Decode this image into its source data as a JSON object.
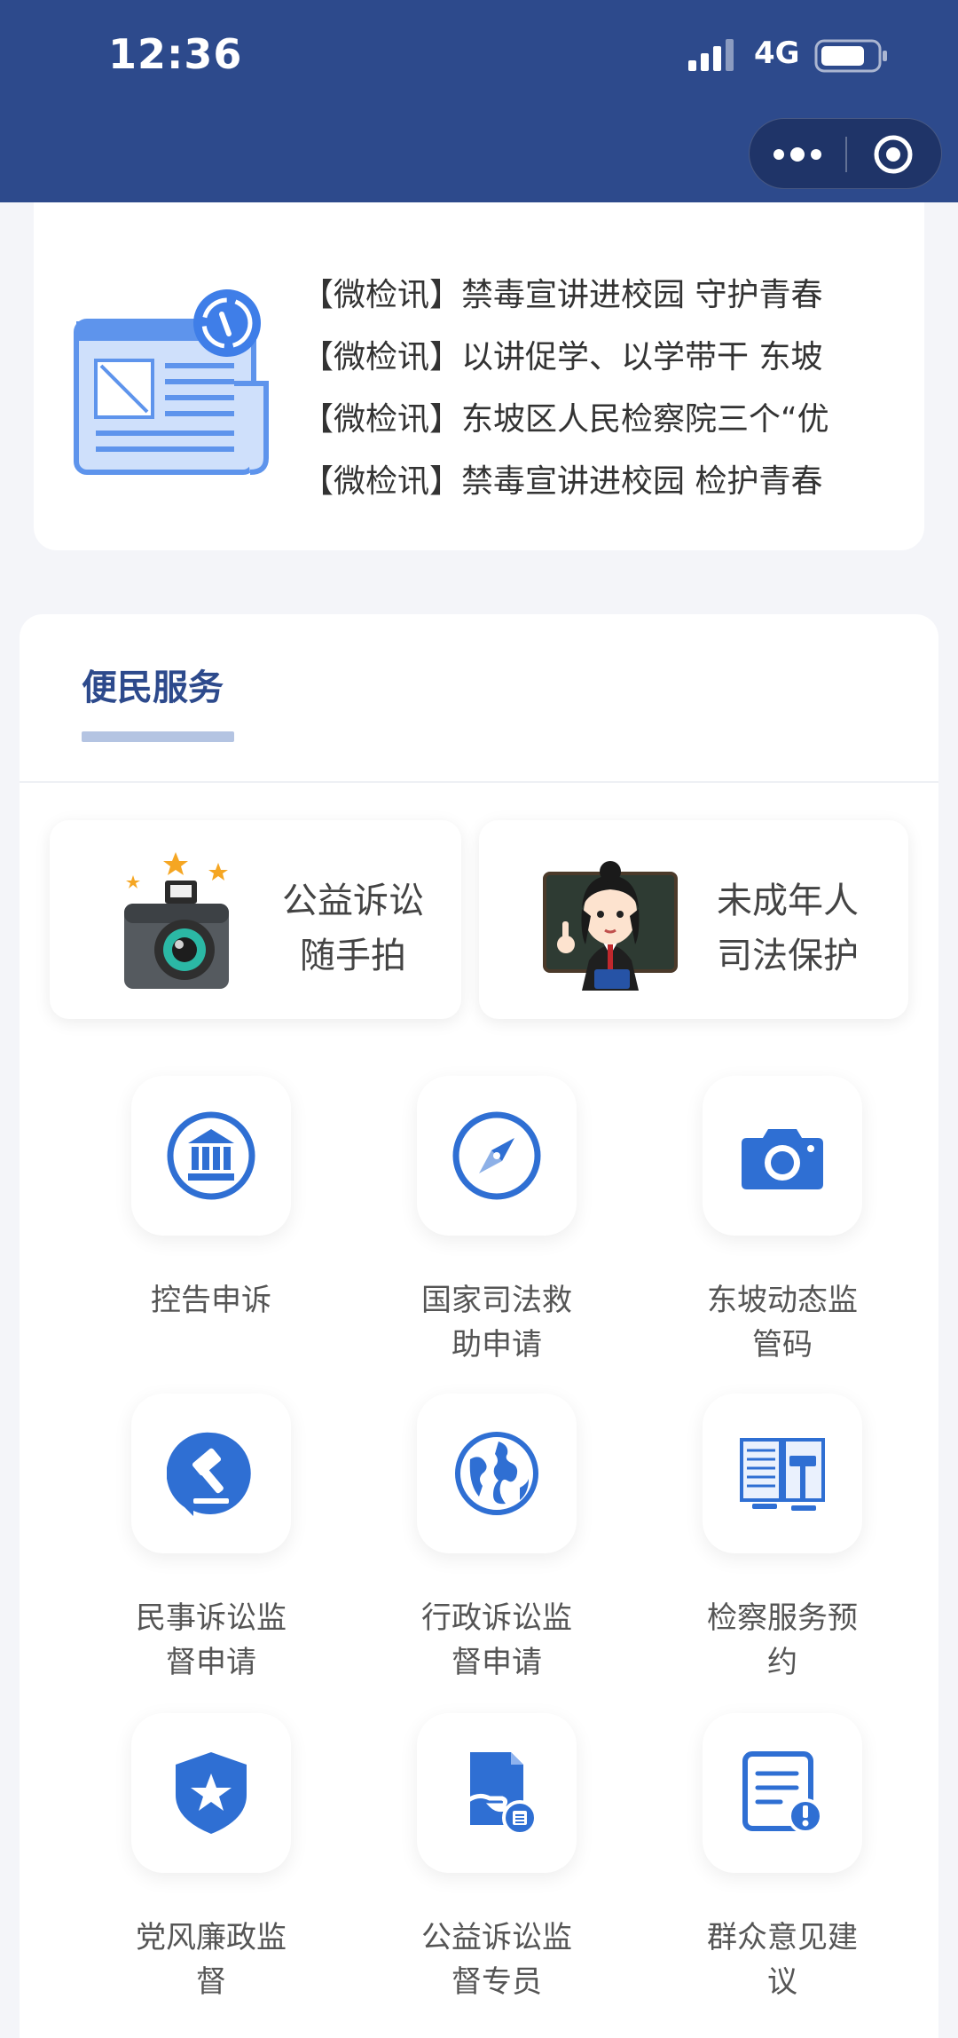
{
  "status_bar": {
    "time": "12:36",
    "network": "4G"
  },
  "news": {
    "items": [
      "【微检讯】禁毒宣讲进校园  守护青春",
      "【微检讯】以讲促学、以学带干 东坡",
      "【微检讯】东坡区人民检察院三个“优",
      "【微检讯】禁毒宣讲进校园  检护青春"
    ]
  },
  "services": {
    "title": "便民服务",
    "features": [
      {
        "line1": "公益诉讼",
        "line2": "随手拍",
        "icon": "camera-icon"
      },
      {
        "line1": "未成年人",
        "line2": "司法保护",
        "icon": "teacher-icon"
      }
    ],
    "grid": [
      {
        "line1": "控告申诉",
        "line2": "",
        "icon": "courthouse-icon"
      },
      {
        "line1": "国家司法救",
        "line2": "助申请",
        "icon": "compass-icon"
      },
      {
        "line1": "东坡动态监",
        "line2": "管码",
        "icon": "photo-camera-icon"
      },
      {
        "line1": "民事诉讼监",
        "line2": "督申请",
        "icon": "gavel-icon"
      },
      {
        "line1": "行政诉讼监",
        "line2": "督申请",
        "icon": "globe-icon"
      },
      {
        "line1": "检察服务预",
        "line2": "约",
        "icon": "law-book-icon"
      },
      {
        "line1": "党风廉政监",
        "line2": "督",
        "icon": "shield-star-icon"
      },
      {
        "line1": "公益诉讼监",
        "line2": "督专员",
        "icon": "document-hand-icon"
      },
      {
        "line1": "群众意见建",
        "line2": "议",
        "icon": "document-alert-icon"
      }
    ]
  },
  "colors": {
    "header": "#2d4a8c",
    "accent": "#2f6fd3",
    "background": "#f4f5f9"
  }
}
